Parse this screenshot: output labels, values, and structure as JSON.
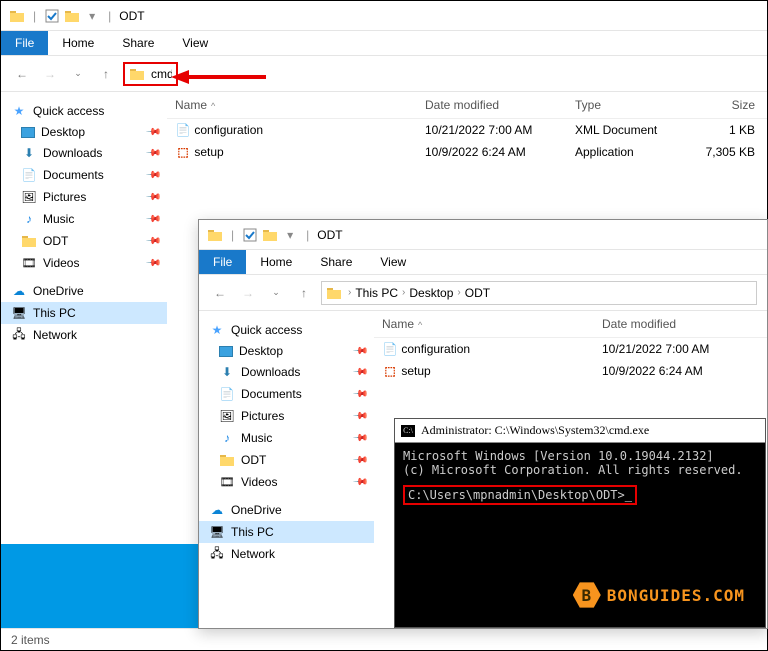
{
  "main": {
    "title": "ODT",
    "tabs": {
      "file": "File",
      "home": "Home",
      "share": "Share",
      "view": "View"
    },
    "address_input": "cmd",
    "columns": {
      "name": "Name",
      "date": "Date modified",
      "type": "Type",
      "size": "Size"
    },
    "files": [
      {
        "name": "configuration",
        "date": "10/21/2022 7:00 AM",
        "type": "XML Document",
        "size": "1 KB"
      },
      {
        "name": "setup",
        "date": "10/9/2022 6:24 AM",
        "type": "Application",
        "size": "7,305 KB"
      }
    ],
    "status": "2 items"
  },
  "sidebar": {
    "quick_access": "Quick access",
    "items": [
      {
        "label": "Desktop"
      },
      {
        "label": "Downloads"
      },
      {
        "label": "Documents"
      },
      {
        "label": "Pictures"
      },
      {
        "label": "Music"
      },
      {
        "label": "ODT"
      },
      {
        "label": "Videos"
      }
    ],
    "onedrive": "OneDrive",
    "this_pc": "This PC",
    "network": "Network"
  },
  "inset": {
    "title": "ODT",
    "tabs": {
      "file": "File",
      "home": "Home",
      "share": "Share",
      "view": "View"
    },
    "breadcrumb": [
      "This PC",
      "Desktop",
      "ODT"
    ],
    "columns": {
      "name": "Name",
      "date": "Date modified"
    },
    "files": [
      {
        "name": "configuration",
        "date": "10/21/2022 7:00 AM"
      },
      {
        "name": "setup",
        "date": "10/9/2022 6:24 AM"
      }
    ],
    "sidebar": {
      "quick_access": "Quick access",
      "items": [
        {
          "label": "Desktop"
        },
        {
          "label": "Downloads"
        },
        {
          "label": "Documents"
        },
        {
          "label": "Pictures"
        },
        {
          "label": "Music"
        },
        {
          "label": "ODT"
        },
        {
          "label": "Videos"
        }
      ],
      "onedrive": "OneDrive",
      "this_pc": "This PC",
      "network": "Network"
    }
  },
  "cmd": {
    "title": "Administrator: C:\\Windows\\System32\\cmd.exe",
    "line1": "Microsoft Windows [Version 10.0.19044.2132]",
    "line2": "(c) Microsoft Corporation. All rights reserved.",
    "prompt": "C:\\Users\\mpnadmin\\Desktop\\ODT>",
    "cursor": "_"
  },
  "logo": {
    "text": "BONGUIDES.COM",
    "letter": "B"
  }
}
